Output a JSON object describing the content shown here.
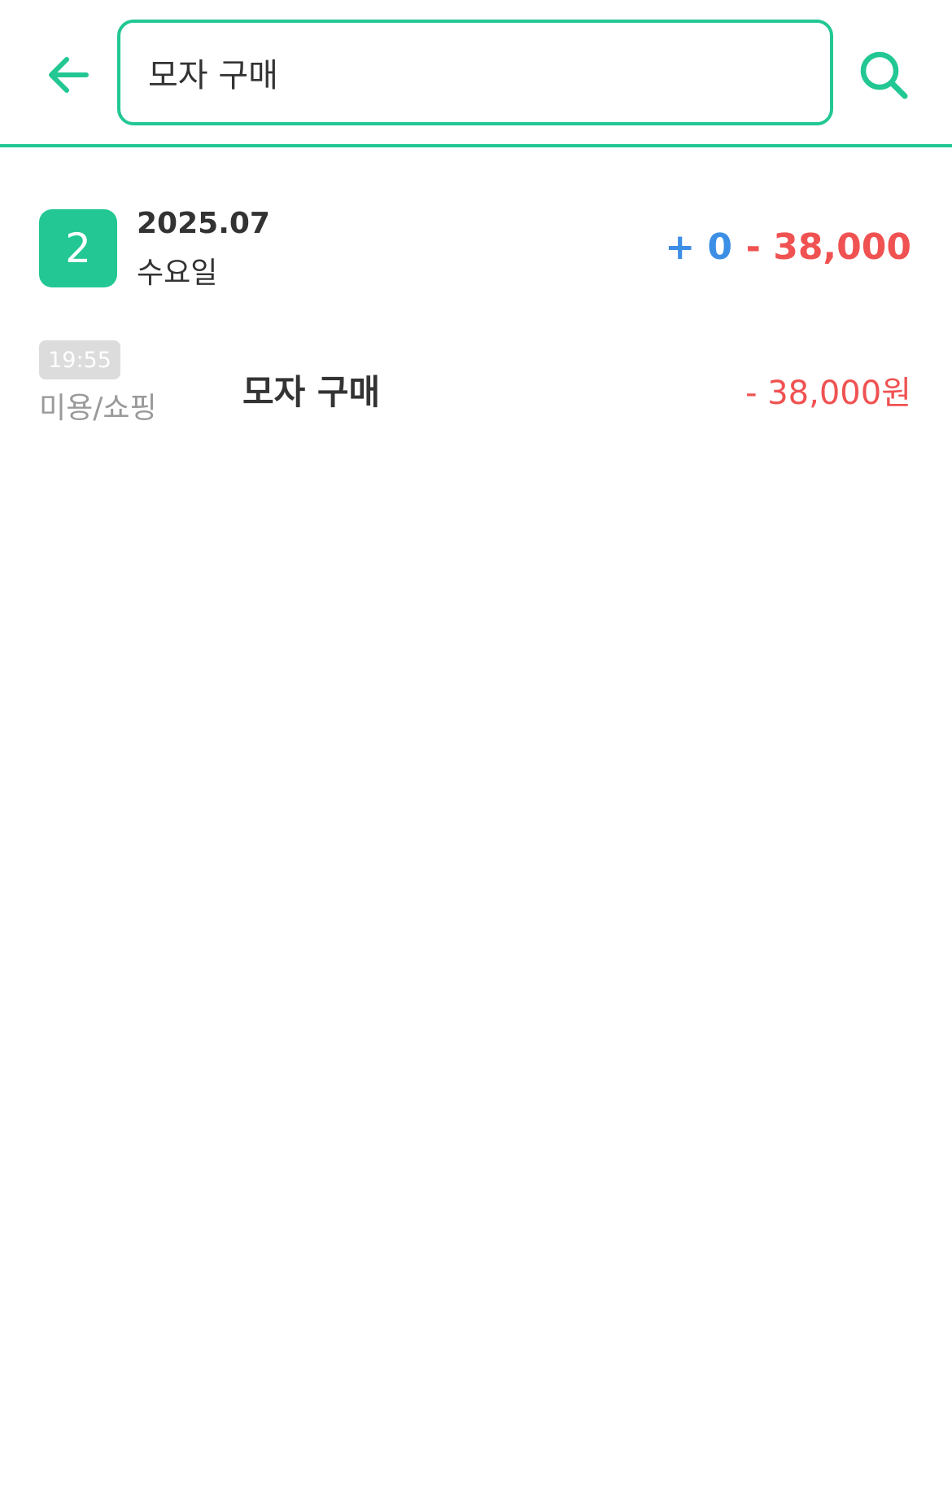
{
  "colors": {
    "accent": "#22c793",
    "income": "#3d8fe6",
    "expense": "#f05252",
    "text": "#333333",
    "muted": "#9a9a9a",
    "time_badge": "#dcdcdc"
  },
  "header": {
    "back_icon": "arrow-left-icon",
    "search_value": "모자 구매",
    "search_icon": "search-icon"
  },
  "day_group": {
    "day": "2",
    "month": "2025.07",
    "weekday": "수요일",
    "income": "+ 0",
    "expense": "- 38,000"
  },
  "transactions": [
    {
      "time": "19:55",
      "category": "미용/쇼핑",
      "title": "모자 구매",
      "amount": "- 38,000원"
    }
  ]
}
